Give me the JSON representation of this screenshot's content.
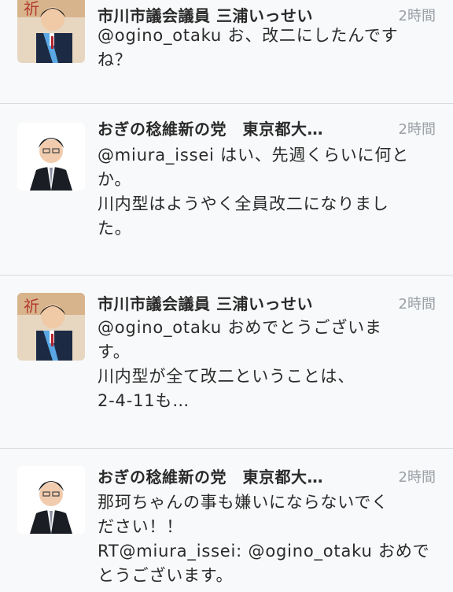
{
  "tweets": [
    {
      "avatar": "avatar-photo-miura",
      "name": "市川市議会議員 三浦いっせい",
      "time": "2時間",
      "lines": [
        "@ogino_otaku お、改二にしたんです",
        "ね？"
      ]
    },
    {
      "avatar": "avatar-photo-ogino",
      "name": "おぎの稔維新の党　東京都大…",
      "time": "2時間",
      "lines": [
        "@miura_issei はい、先週くらいに何と",
        "か。",
        "川内型はようやく全員改二になりまし",
        "た。"
      ]
    },
    {
      "avatar": "avatar-photo-miura",
      "name": "市川市議会議員 三浦いっせい",
      "time": "2時間",
      "lines": [
        "@ogino_otaku おめでとうございま",
        "す。",
        "川内型が全て改二ということは、",
        "2-4-11も…"
      ]
    },
    {
      "avatar": "avatar-photo-ogino",
      "name": "おぎの稔維新の党　東京都大…",
      "time": "2時間",
      "lines": [
        "那珂ちゃんの事も嫌いにならないでく",
        "ださい！！",
        "RT@miura_issei: @ogino_otaku おめで",
        "とうございます。"
      ]
    }
  ]
}
